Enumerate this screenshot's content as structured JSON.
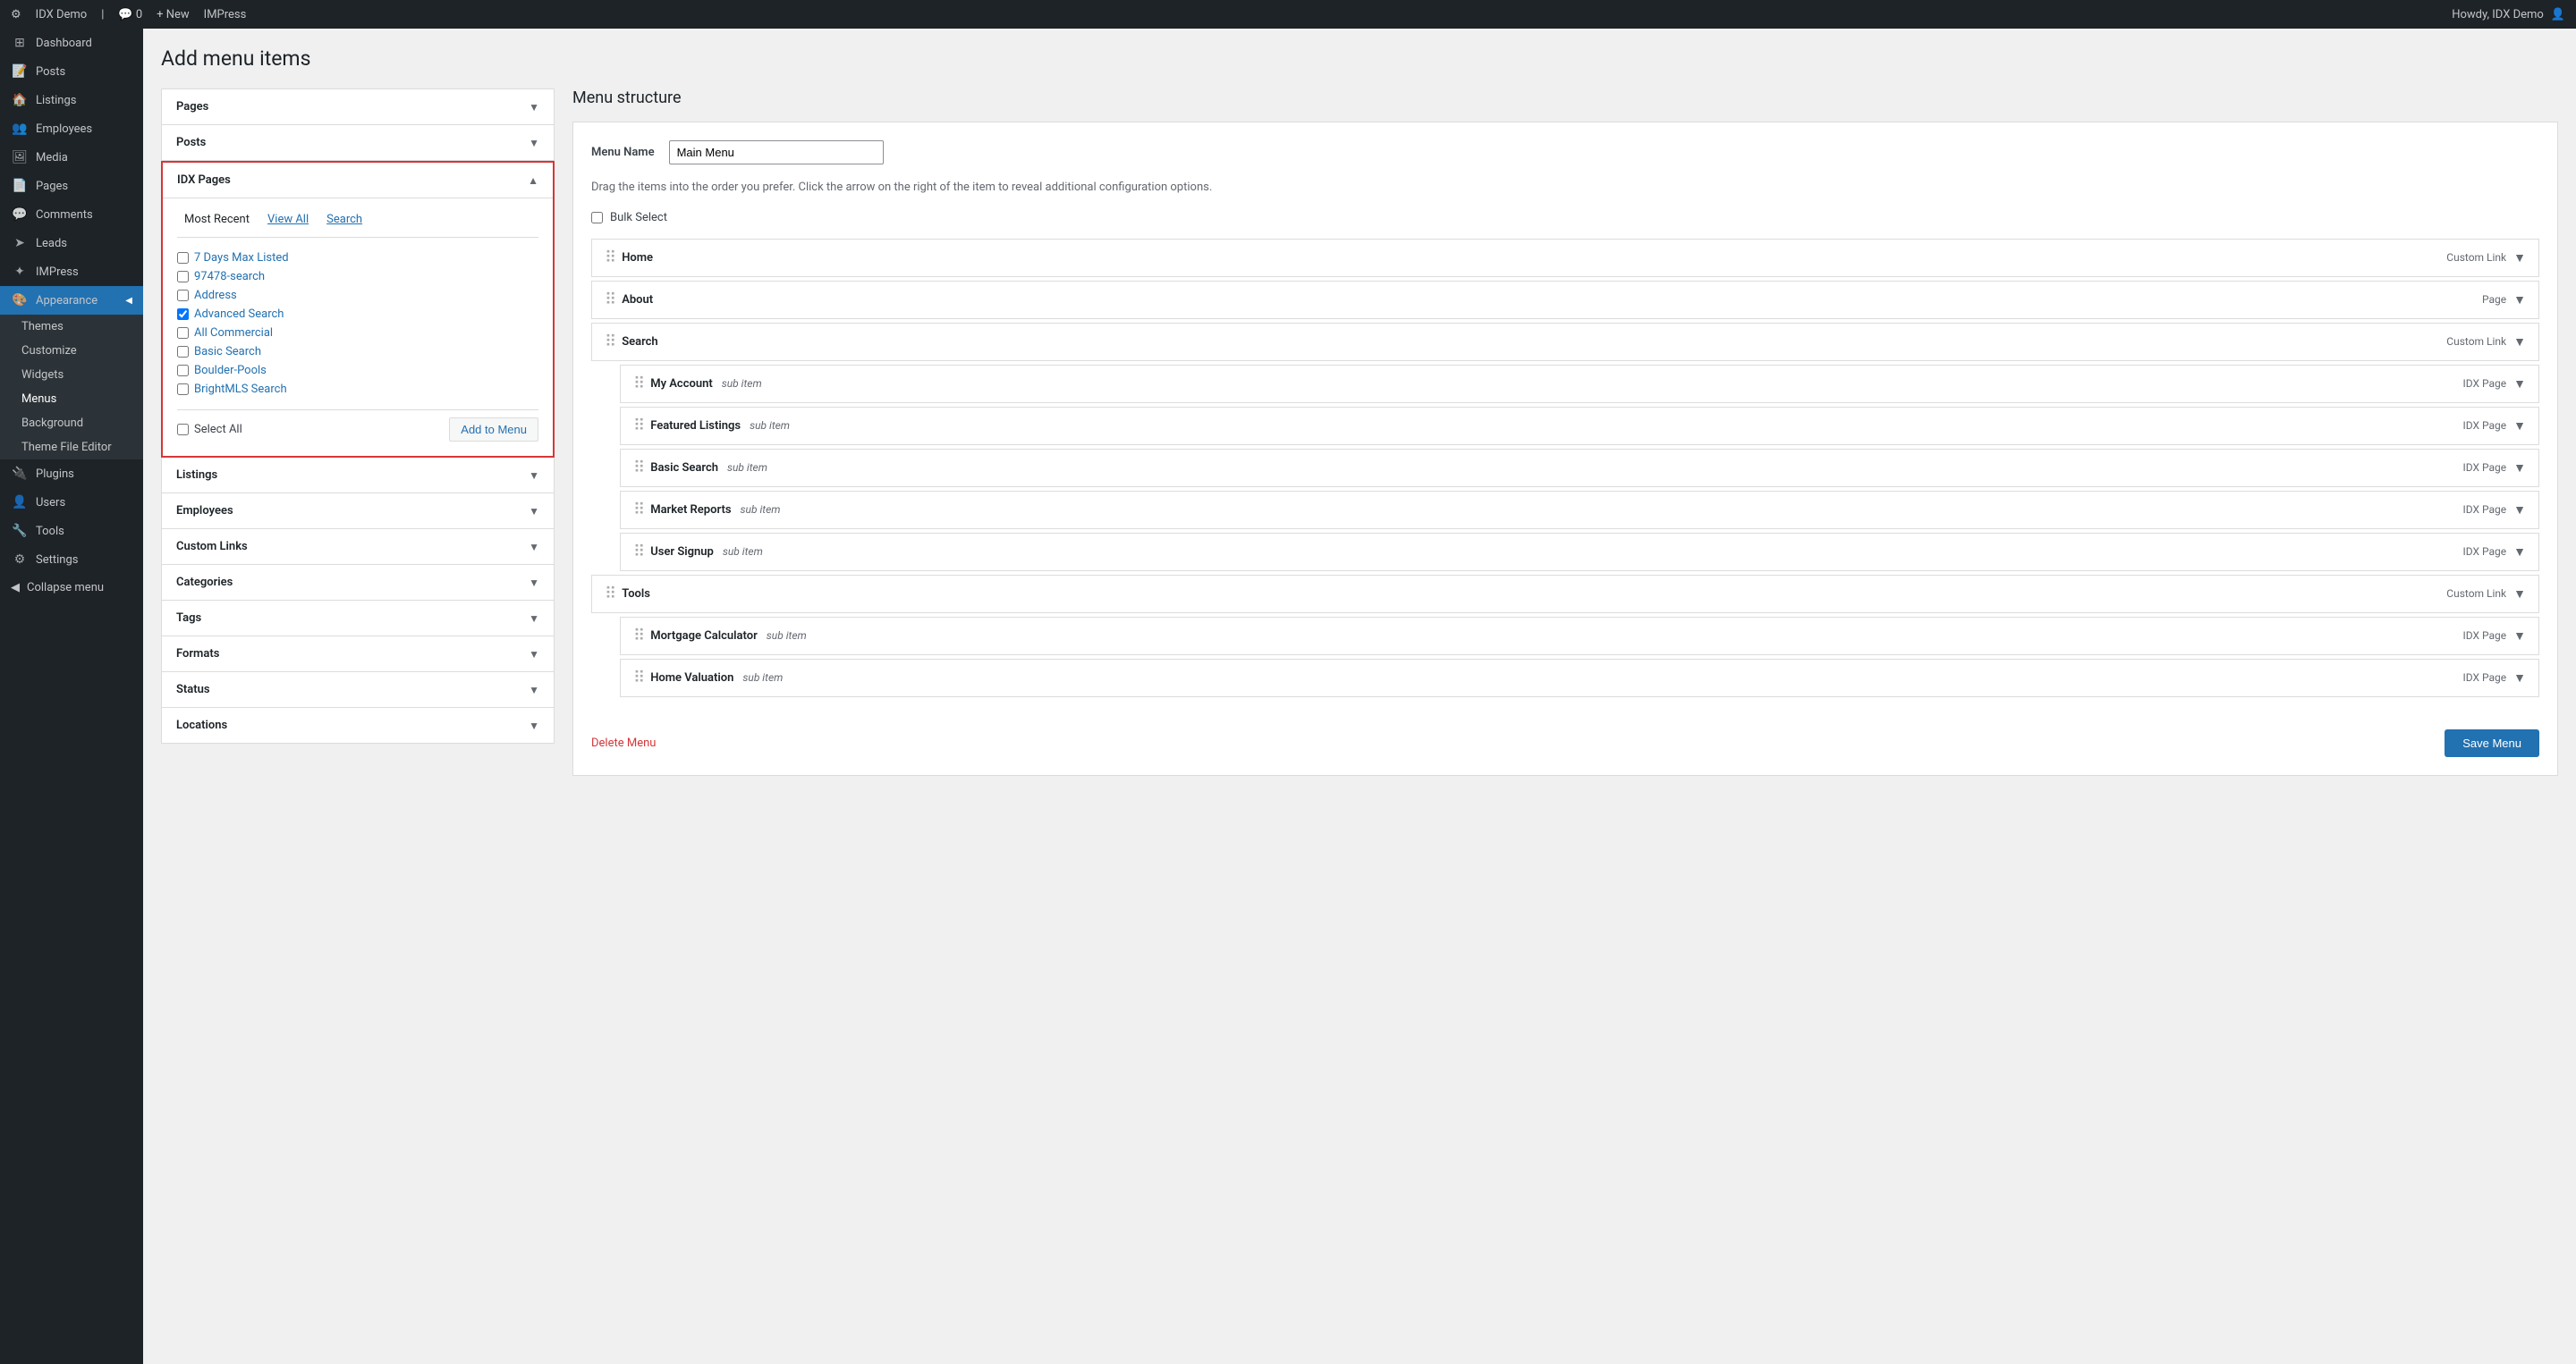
{
  "adminBar": {
    "logo": "⚙",
    "siteName": "IDX Demo",
    "comments": "0",
    "newLabel": "+ New",
    "impress": "IMPress",
    "howdy": "Howdy, IDX Demo",
    "avatar": "👤"
  },
  "sidebar": {
    "items": [
      {
        "id": "dashboard",
        "label": "Dashboard",
        "icon": "⊞"
      },
      {
        "id": "posts",
        "label": "Posts",
        "icon": "📝"
      },
      {
        "id": "listings",
        "label": "Listings",
        "icon": "🏠"
      },
      {
        "id": "employees",
        "label": "Employees",
        "icon": "👥"
      },
      {
        "id": "media",
        "label": "Media",
        "icon": "🖼"
      },
      {
        "id": "pages",
        "label": "Pages",
        "icon": "📄"
      },
      {
        "id": "comments",
        "label": "Comments",
        "icon": "💬"
      },
      {
        "id": "leads",
        "label": "Leads",
        "icon": "➤"
      },
      {
        "id": "impress",
        "label": "IMPress",
        "icon": "✦"
      },
      {
        "id": "appearance",
        "label": "Appearance",
        "icon": "🎨",
        "active": true
      },
      {
        "id": "themes",
        "label": "Themes",
        "sub": true
      },
      {
        "id": "customize",
        "label": "Customize",
        "sub": true
      },
      {
        "id": "widgets",
        "label": "Widgets",
        "sub": true
      },
      {
        "id": "menus",
        "label": "Menus",
        "sub": true,
        "active": true
      },
      {
        "id": "background",
        "label": "Background",
        "sub": true
      },
      {
        "id": "theme-file-editor",
        "label": "Theme File Editor",
        "sub": true
      },
      {
        "id": "plugins",
        "label": "Plugins",
        "icon": "🔌"
      },
      {
        "id": "users",
        "label": "Users",
        "icon": "👤"
      },
      {
        "id": "tools",
        "label": "Tools",
        "icon": "🔧"
      },
      {
        "id": "settings",
        "label": "Settings",
        "icon": "⚙"
      },
      {
        "id": "collapse",
        "label": "Collapse menu",
        "icon": "◀"
      }
    ]
  },
  "pageTitle": "Add menu items",
  "leftPanel": {
    "sections": [
      {
        "id": "pages",
        "label": "Pages",
        "collapsed": true
      },
      {
        "id": "posts",
        "label": "Posts",
        "collapsed": true
      },
      {
        "id": "idxpages",
        "label": "IDX Pages",
        "collapsed": false,
        "highlighted": true,
        "tabs": [
          {
            "id": "most-recent",
            "label": "Most Recent",
            "active": true
          },
          {
            "id": "view-all",
            "label": "View All",
            "active": false
          },
          {
            "id": "search",
            "label": "Search",
            "active": false
          }
        ],
        "items": [
          {
            "id": "7days",
            "label": "7 Days Max Listed",
            "checked": false
          },
          {
            "id": "97478",
            "label": "97478-search",
            "checked": false
          },
          {
            "id": "address",
            "label": "Address",
            "checked": false
          },
          {
            "id": "advanced-search",
            "label": "Advanced Search",
            "checked": true
          },
          {
            "id": "all-commercial",
            "label": "All Commercial",
            "checked": false
          },
          {
            "id": "basic-search",
            "label": "Basic Search",
            "checked": false
          },
          {
            "id": "boulder-pools",
            "label": "Boulder-Pools",
            "checked": false
          },
          {
            "id": "brightmls",
            "label": "BrightMLS Search",
            "checked": false
          }
        ],
        "selectAllLabel": "Select All",
        "addToMenuLabel": "Add to Menu"
      },
      {
        "id": "listings",
        "label": "Listings",
        "collapsed": true
      },
      {
        "id": "employees",
        "label": "Employees",
        "collapsed": true
      },
      {
        "id": "custom-links",
        "label": "Custom Links",
        "collapsed": true
      },
      {
        "id": "categories",
        "label": "Categories",
        "collapsed": true
      },
      {
        "id": "tags",
        "label": "Tags",
        "collapsed": true
      },
      {
        "id": "formats",
        "label": "Formats",
        "collapsed": true
      },
      {
        "id": "status",
        "label": "Status",
        "collapsed": true
      },
      {
        "id": "locations",
        "label": "Locations",
        "collapsed": true
      }
    ]
  },
  "rightPanel": {
    "sectionTitle": "Menu structure",
    "menuNameLabel": "Menu Name",
    "menuNameValue": "Main Menu",
    "dragInstructions": "Drag the items into the order you prefer. Click the arrow on the right of the item to reveal additional configuration options.",
    "bulkSelectLabel": "Bulk Select",
    "menuItems": [
      {
        "id": "home",
        "title": "Home",
        "type": "Custom Link",
        "subItem": false
      },
      {
        "id": "about",
        "title": "About",
        "type": "Page",
        "subItem": false
      },
      {
        "id": "search",
        "title": "Search",
        "type": "Custom Link",
        "subItem": false
      },
      {
        "id": "my-account",
        "title": "My Account",
        "type": "IDX Page",
        "subItem": true,
        "subLabel": "sub item"
      },
      {
        "id": "featured-listings",
        "title": "Featured Listings",
        "type": "IDX Page",
        "subItem": true,
        "subLabel": "sub item"
      },
      {
        "id": "basic-search-item",
        "title": "Basic Search",
        "type": "IDX Page",
        "subItem": true,
        "subLabel": "sub item"
      },
      {
        "id": "market-reports",
        "title": "Market Reports",
        "type": "IDX Page",
        "subItem": true,
        "subLabel": "sub item"
      },
      {
        "id": "user-signup",
        "title": "User Signup",
        "type": "IDX Page",
        "subItem": true,
        "subLabel": "sub item"
      },
      {
        "id": "tools",
        "title": "Tools",
        "type": "Custom Link",
        "subItem": false
      },
      {
        "id": "mortgage-calculator",
        "title": "Mortgage Calculator",
        "type": "IDX Page",
        "subItem": true,
        "subLabel": "sub item"
      },
      {
        "id": "home-valuation",
        "title": "Home Valuation",
        "type": "IDX Page",
        "subItem": true,
        "subLabel": "sub item"
      }
    ],
    "deleteMenuLabel": "Delete Menu",
    "saveMenuLabel": "Save Menu"
  }
}
